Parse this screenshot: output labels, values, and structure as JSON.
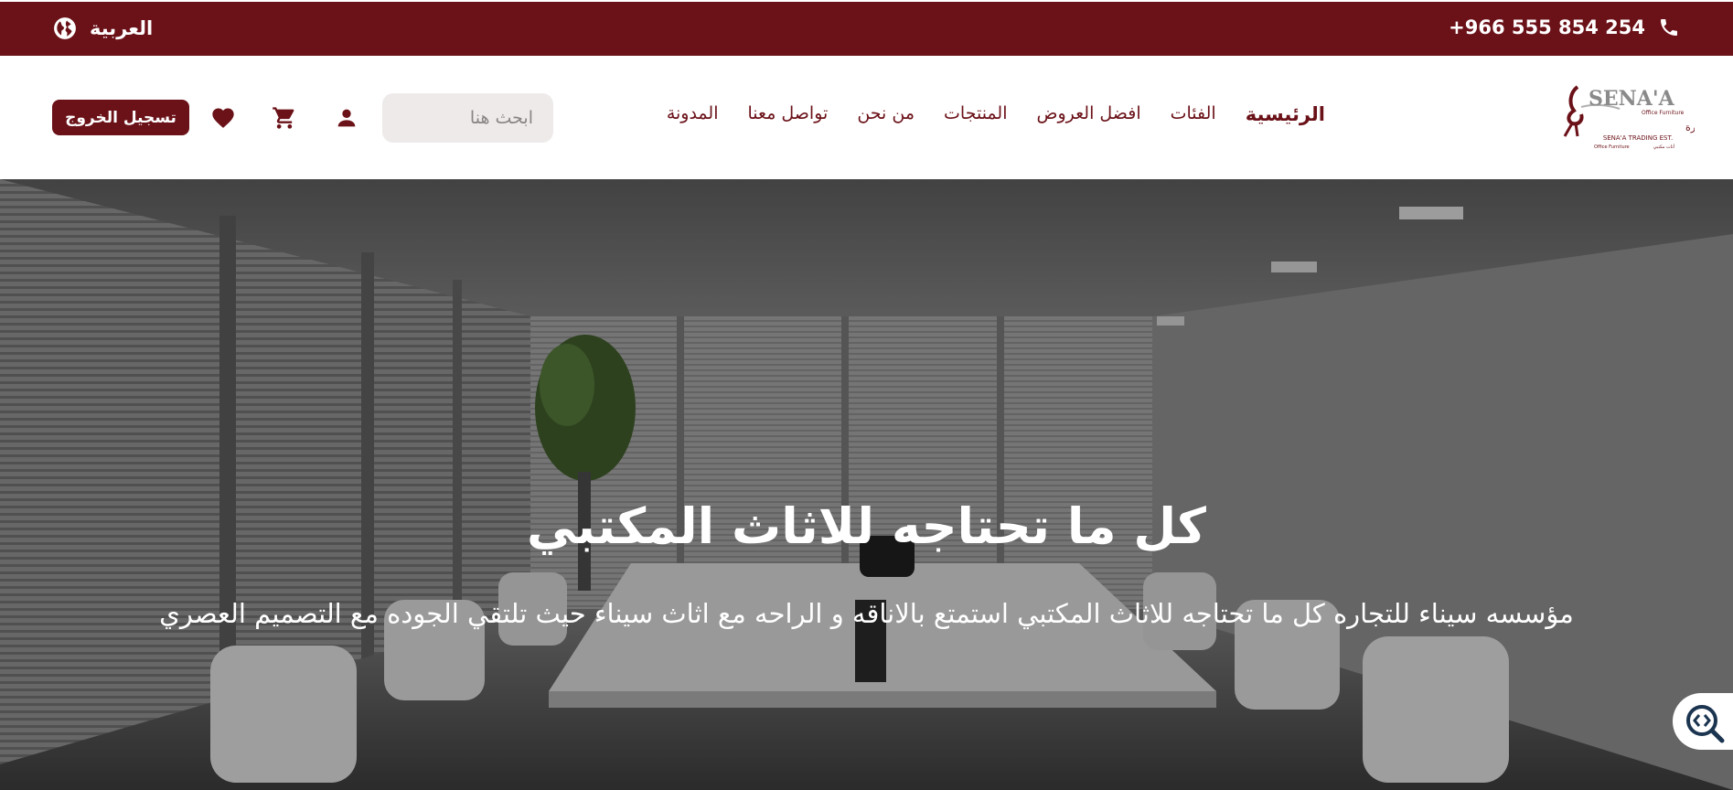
{
  "topbar": {
    "language_label": "العربية",
    "phone_number": "+966 555 854 254",
    "language_icon": "globe-icon",
    "phone_icon": "phone-icon"
  },
  "header": {
    "logo": {
      "brand_text": "SENA'A",
      "tagline": "Office Furniture",
      "arabic_name": "مؤسسة سيناء للتجارة",
      "english_name": "SENA'A TRADING EST."
    },
    "nav": [
      {
        "label": "الرئيسية",
        "active": true
      },
      {
        "label": "الفئات",
        "active": false
      },
      {
        "label": "افضل العروض",
        "active": false
      },
      {
        "label": "المنتجات",
        "active": false
      },
      {
        "label": "من نحن",
        "active": false
      },
      {
        "label": "تواصل معنا",
        "active": false
      },
      {
        "label": "المدونة",
        "active": false
      }
    ],
    "search_placeholder": "ابحث هنا",
    "logout_label": "تسجيل الخروج",
    "icons": [
      "user-icon",
      "cart-icon",
      "heart-icon"
    ]
  },
  "hero": {
    "title": "كل ما تحتاجه للاثاث المكتبي",
    "subtitle": "مؤسسه سيناء للتجاره كل ما تحتاجه للاثاث المكتبي استمتع بالاناقه و الراحه مع اثاث سيناء حيث تلتقي الجوده مع التصميم العصري"
  },
  "colors": {
    "brand": "#6b1118",
    "search_bg": "#eeeaea",
    "white": "#ffffff"
  }
}
